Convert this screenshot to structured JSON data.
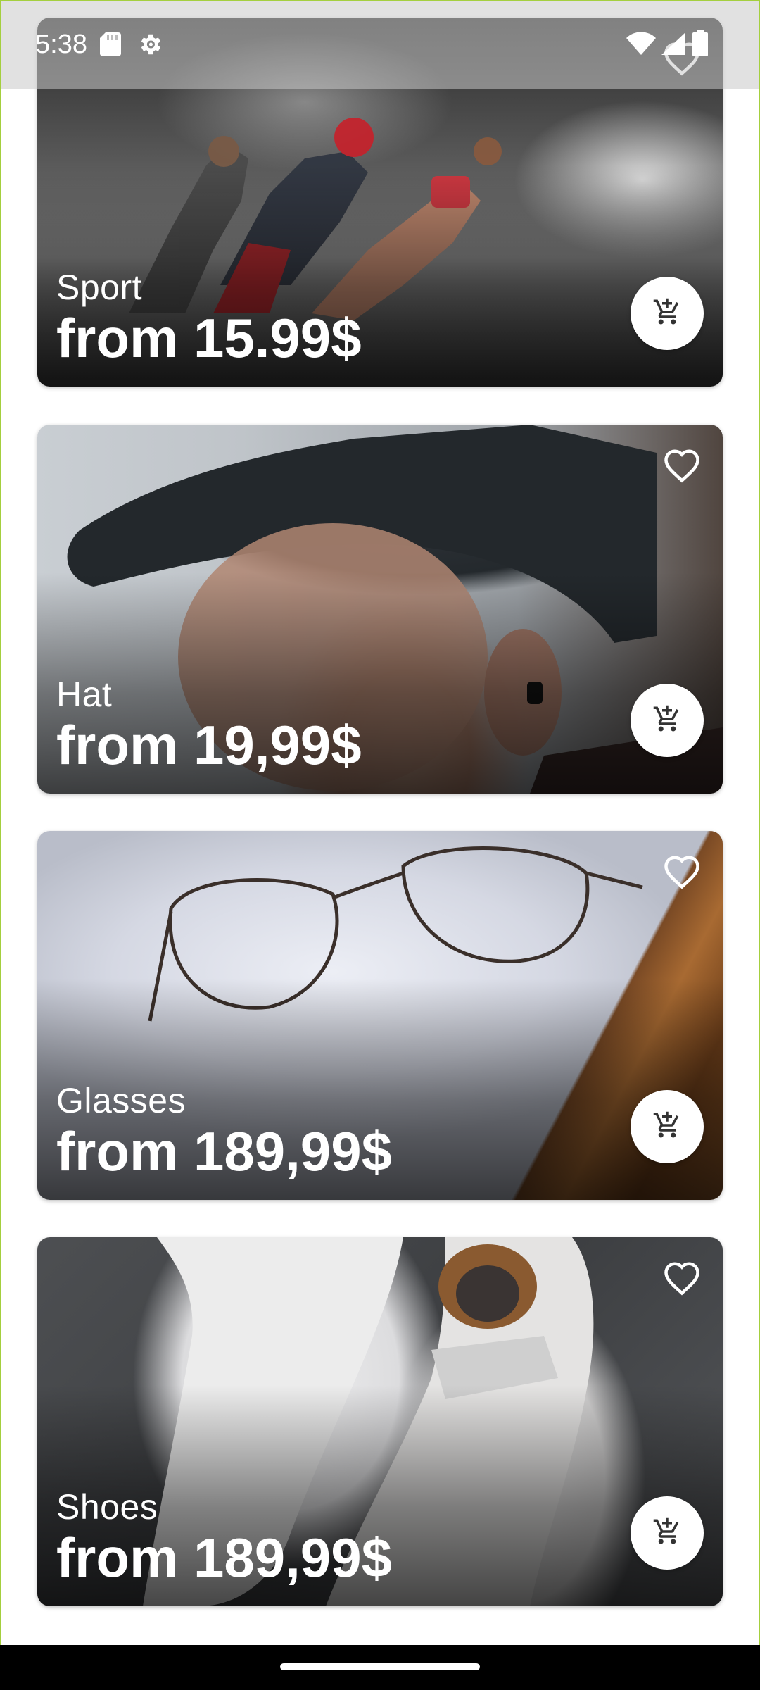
{
  "status_bar": {
    "time": "5:38",
    "icons": [
      "sd-card-icon",
      "settings-gear-icon",
      "wifi-icon",
      "cell-signal-icon",
      "battery-icon"
    ]
  },
  "products": [
    {
      "category": "Sport",
      "price": "from 15.99$",
      "photo": "athletes-running"
    },
    {
      "category": "Hat",
      "price": "from 19,99$",
      "photo": "man-in-cap"
    },
    {
      "category": "Glasses",
      "price": "from 189,99$",
      "photo": "eyeglasses-on-table"
    },
    {
      "category": "Shoes",
      "price": "from 189,99$",
      "photo": "white-sneakers"
    }
  ],
  "colors": {
    "accent_border": "#a4cf3e",
    "card_text": "#ffffff",
    "cart_button_bg": "#ffffff",
    "cart_icon": "#333333"
  }
}
